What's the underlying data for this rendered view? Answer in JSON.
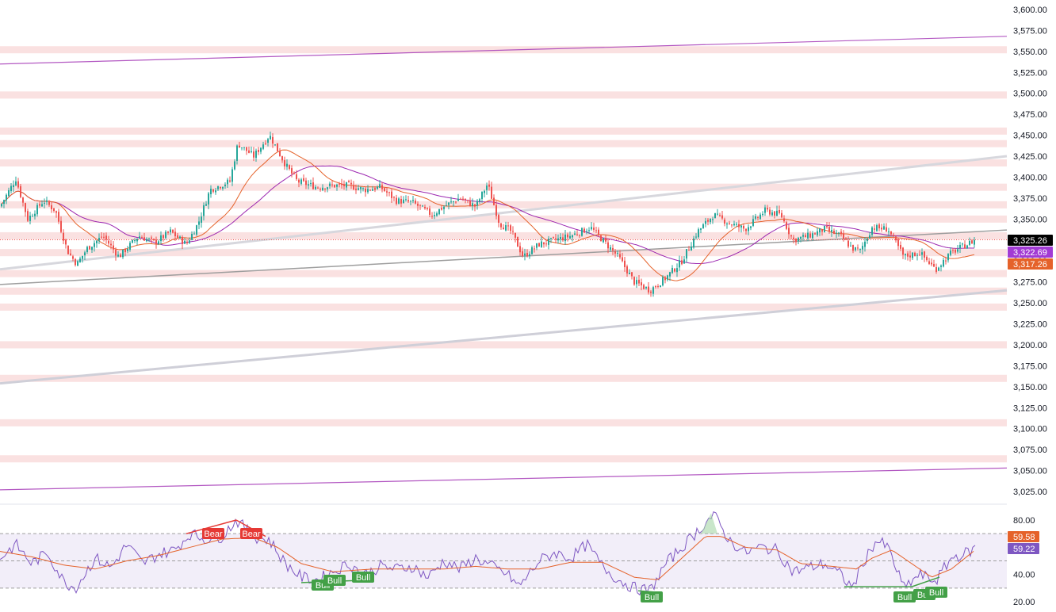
{
  "colors": {
    "up": "#26a69a",
    "down": "#ef5350",
    "ma_fast": "#e5622a",
    "ma_slow": "#9c27b0",
    "rsi_line": "#7e57c2",
    "rsi_ma": "#e5622a",
    "zone": "#f8d7d7",
    "channel_purple": "#ab47bc",
    "trend_grey": "#9e9e9e",
    "last_price_bg": "#000000",
    "bull_label": "#43a047",
    "bear_label": "#e53935"
  },
  "price_axis": {
    "ticks": [
      "3,600.00",
      "3,575.00",
      "3,550.00",
      "3,525.00",
      "3,500.00",
      "3,475.00",
      "3,450.00",
      "3,425.00",
      "3,400.00",
      "3,375.00",
      "3,350.00",
      "3,325.00",
      "3,300.00",
      "3,275.00",
      "3,250.00",
      "3,225.00",
      "3,200.00",
      "3,175.00",
      "3,150.00",
      "3,125.00",
      "3,100.00",
      "3,075.00",
      "3,050.00",
      "3,025.00"
    ],
    "last_price": "3,325.26",
    "ma_slow_value": "3,322.69",
    "ma_fast_value": "3,317.26"
  },
  "rsi_axis": {
    "ticks": [
      "80.00",
      "40.00",
      "20.00"
    ],
    "rsi_ma_value": "59.58",
    "rsi_value": "59.22"
  },
  "signals": [
    {
      "text": "Bear",
      "kind": "bear"
    },
    {
      "text": "Bear",
      "kind": "bear"
    },
    {
      "text": "Bull",
      "kind": "bull"
    },
    {
      "text": "Bull",
      "kind": "bull"
    },
    {
      "text": "Bull",
      "kind": "bull"
    },
    {
      "text": "Bull",
      "kind": "bull"
    },
    {
      "text": "Bull",
      "kind": "bull"
    },
    {
      "text": "Bull",
      "kind": "bull"
    },
    {
      "text": "Bull",
      "kind": "bull"
    }
  ],
  "chart_data": [
    {
      "type": "candlestick",
      "y_range": [
        3012.5,
        3612.5
      ],
      "last_price": 3325.26,
      "resistance_zones": [
        3552,
        3498,
        3455,
        3440,
        3417,
        3388,
        3367,
        3350,
        3330,
        3310,
        3285,
        3264,
        3245,
        3200,
        3160,
        3107,
        3064
      ],
      "trendlines": [
        {
          "name": "upper channel",
          "from": 3535,
          "to": 3568
        },
        {
          "name": "mid channel",
          "from": 3290,
          "to": 3425
        },
        {
          "name": "base trend",
          "from": 3272,
          "to": 3337
        },
        {
          "name": "lower channel",
          "from": 3154,
          "to": 3265
        },
        {
          "name": "bottom channel",
          "from": 3027,
          "to": 3053
        }
      ],
      "price_path": [
        [
          0,
          3365
        ],
        [
          20,
          3398
        ],
        [
          35,
          3350
        ],
        [
          55,
          3372
        ],
        [
          70,
          3360
        ],
        [
          85,
          3312
        ],
        [
          97,
          3296
        ],
        [
          110,
          3315
        ],
        [
          130,
          3330
        ],
        [
          150,
          3305
        ],
        [
          175,
          3330
        ],
        [
          195,
          3322
        ],
        [
          215,
          3335
        ],
        [
          235,
          3320
        ],
        [
          250,
          3345
        ],
        [
          265,
          3385
        ],
        [
          290,
          3395
        ],
        [
          300,
          3440
        ],
        [
          320,
          3425
        ],
        [
          340,
          3450
        ],
        [
          360,
          3415
        ],
        [
          375,
          3395
        ],
        [
          400,
          3388
        ],
        [
          420,
          3390
        ],
        [
          440,
          3390
        ],
        [
          460,
          3385
        ],
        [
          480,
          3388
        ],
        [
          500,
          3372
        ],
        [
          520,
          3370
        ],
        [
          545,
          3355
        ],
        [
          560,
          3365
        ],
        [
          580,
          3375
        ],
        [
          600,
          3365
        ],
        [
          615,
          3392
        ],
        [
          630,
          3345
        ],
        [
          645,
          3335
        ],
        [
          660,
          3305
        ],
        [
          680,
          3320
        ],
        [
          700,
          3325
        ],
        [
          720,
          3330
        ],
        [
          745,
          3340
        ],
        [
          760,
          3325
        ],
        [
          780,
          3305
        ],
        [
          800,
          3275
        ],
        [
          820,
          3265
        ],
        [
          840,
          3280
        ],
        [
          860,
          3300
        ],
        [
          880,
          3335
        ],
        [
          900,
          3355
        ],
        [
          920,
          3345
        ],
        [
          940,
          3338
        ],
        [
          965,
          3360
        ],
        [
          985,
          3355
        ],
        [
          1000,
          3325
        ],
        [
          1020,
          3330
        ],
        [
          1040,
          3338
        ],
        [
          1060,
          3330
        ],
        [
          1075,
          3315
        ],
        [
          1085,
          3312
        ],
        [
          1100,
          3340
        ],
        [
          1120,
          3338
        ],
        [
          1140,
          3305
        ],
        [
          1160,
          3310
        ],
        [
          1180,
          3290
        ],
        [
          1200,
          3310
        ],
        [
          1230,
          3325
        ]
      ],
      "moving_averages": [
        {
          "name": "fast",
          "value": 3317.26
        },
        {
          "name": "slow",
          "value": 3322.69
        }
      ]
    },
    {
      "type": "line",
      "indicator": "RSI",
      "y_range": [
        16,
        86
      ],
      "levels": [
        70,
        50,
        30
      ],
      "rsi_value": 59.22,
      "rsi_ma_value": 59.58,
      "rsi_path": [
        [
          0,
          52
        ],
        [
          20,
          62
        ],
        [
          40,
          48
        ],
        [
          60,
          56
        ],
        [
          80,
          35
        ],
        [
          95,
          30
        ],
        [
          120,
          52
        ],
        [
          140,
          45
        ],
        [
          160,
          62
        ],
        [
          180,
          48
        ],
        [
          200,
          55
        ],
        [
          220,
          58
        ],
        [
          240,
          70
        ],
        [
          260,
          66
        ],
        [
          280,
          68
        ],
        [
          298,
          80
        ],
        [
          320,
          68
        ],
        [
          340,
          65
        ],
        [
          360,
          48
        ],
        [
          380,
          38
        ],
        [
          400,
          36
        ],
        [
          420,
          42
        ],
        [
          440,
          48
        ],
        [
          460,
          40
        ],
        [
          480,
          46
        ],
        [
          500,
          44
        ],
        [
          520,
          46
        ],
        [
          540,
          38
        ],
        [
          560,
          50
        ],
        [
          580,
          44
        ],
        [
          600,
          52
        ],
        [
          620,
          46
        ],
        [
          640,
          40
        ],
        [
          655,
          31
        ],
        [
          680,
          50
        ],
        [
          700,
          56
        ],
        [
          720,
          52
        ],
        [
          740,
          62
        ],
        [
          760,
          46
        ],
        [
          780,
          36
        ],
        [
          800,
          30
        ],
        [
          820,
          28
        ],
        [
          840,
          48
        ],
        [
          860,
          60
        ],
        [
          880,
          72
        ],
        [
          900,
          84
        ],
        [
          920,
          65
        ],
        [
          940,
          56
        ],
        [
          960,
          60
        ],
        [
          980,
          58
        ],
        [
          1000,
          42
        ],
        [
          1020,
          45
        ],
        [
          1040,
          48
        ],
        [
          1060,
          40
        ],
        [
          1075,
          30
        ],
        [
          1090,
          50
        ],
        [
          1105,
          65
        ],
        [
          1120,
          60
        ],
        [
          1140,
          30
        ],
        [
          1160,
          40
        ],
        [
          1180,
          35
        ],
        [
          1200,
          52
        ],
        [
          1220,
          56
        ],
        [
          1230,
          59
        ]
      ],
      "rsi_ma_path": [
        [
          0,
          57
        ],
        [
          40,
          53
        ],
        [
          80,
          47
        ],
        [
          120,
          44
        ],
        [
          160,
          50
        ],
        [
          200,
          54
        ],
        [
          240,
          60
        ],
        [
          280,
          66
        ],
        [
          320,
          67
        ],
        [
          350,
          60
        ],
        [
          380,
          48
        ],
        [
          420,
          42
        ],
        [
          470,
          44
        ],
        [
          520,
          44
        ],
        [
          560,
          44
        ],
        [
          600,
          46
        ],
        [
          640,
          44
        ],
        [
          680,
          44
        ],
        [
          720,
          49
        ],
        [
          760,
          49
        ],
        [
          800,
          38
        ],
        [
          830,
          36
        ],
        [
          860,
          52
        ],
        [
          890,
          68
        ],
        [
          910,
          68
        ],
        [
          940,
          60
        ],
        [
          980,
          58
        ],
        [
          1010,
          48
        ],
        [
          1050,
          46
        ],
        [
          1080,
          44
        ],
        [
          1100,
          52
        ],
        [
          1125,
          58
        ],
        [
          1150,
          48
        ],
        [
          1175,
          38
        ],
        [
          1200,
          44
        ],
        [
          1230,
          58
        ]
      ]
    }
  ]
}
